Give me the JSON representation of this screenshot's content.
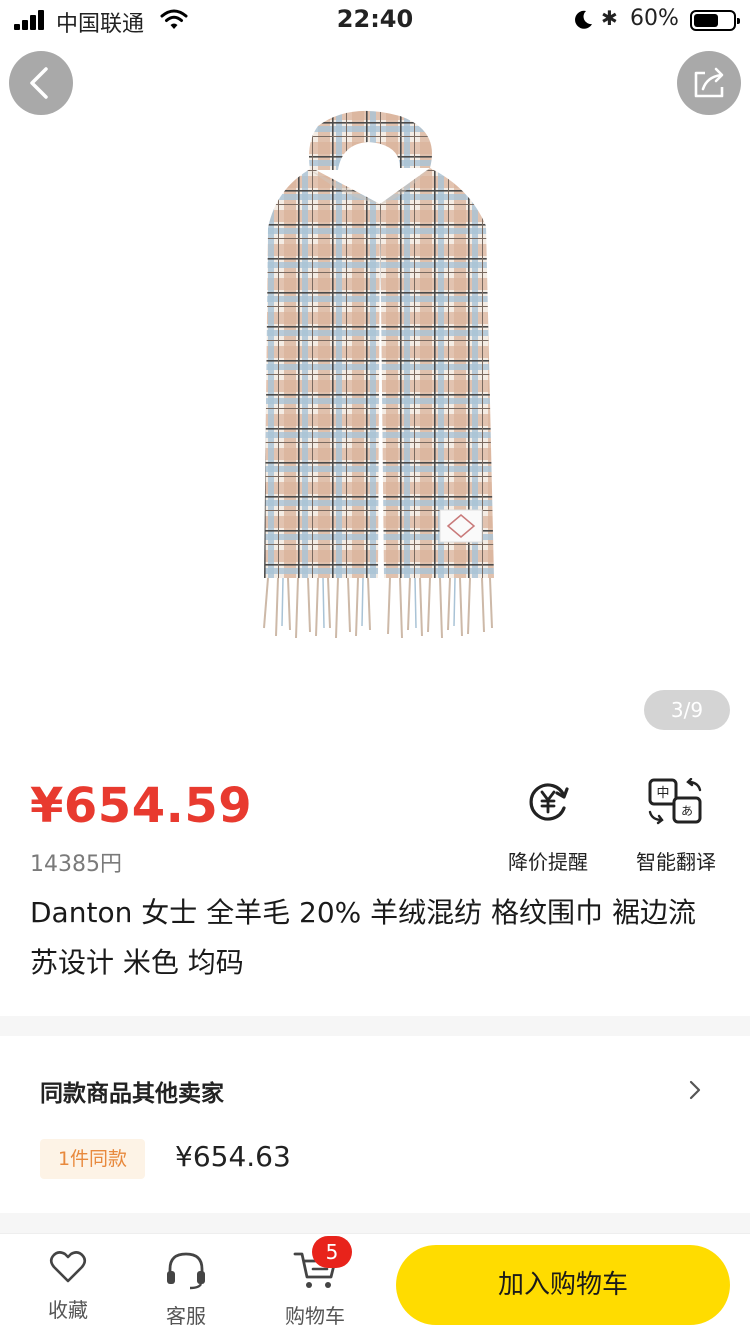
{
  "status_bar": {
    "carrier": "中国联通",
    "time": "22:40",
    "battery": "60%"
  },
  "gallery": {
    "pager": "3/9",
    "image_subject": "plaid wool scarf with fringe"
  },
  "product": {
    "price": "¥654.59",
    "original_price": "14385円",
    "title": "Danton 女士 全羊毛 20% 羊绒混纺 格纹围巾 裾边流苏设计 米色 均码"
  },
  "actions": {
    "price_alert_label": "降价提醒",
    "translate_label": "智能翻译",
    "translate_icon_chars": [
      "中",
      "あ"
    ]
  },
  "other_sellers": {
    "title": "同款商品其他卖家",
    "badge": "1件同款",
    "price": "¥654.63"
  },
  "bottom_bar": {
    "favorite_label": "收藏",
    "service_label": "客服",
    "cart_label": "购物车",
    "cart_count": "5",
    "add_to_cart_label": "加入购物车"
  },
  "colors": {
    "price_red": "#e83a2f",
    "cta_yellow": "#ffdc00",
    "badge_orange": "#e8893d"
  },
  "icons": [
    "signal-icon",
    "wifi-icon",
    "moon-icon",
    "bluetooth-icon",
    "battery-icon",
    "back-arrow-icon",
    "share-icon",
    "yen-refresh-icon",
    "translate-icon",
    "chevron-right-icon",
    "heart-icon",
    "headset-icon",
    "cart-icon"
  ]
}
